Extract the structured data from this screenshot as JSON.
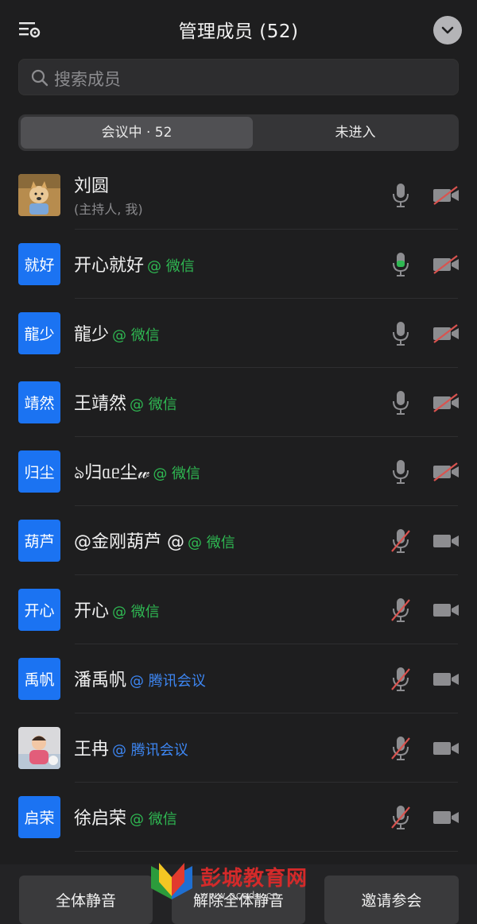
{
  "header": {
    "title": "管理成员 (52)",
    "settings_icon": "list-settings-icon",
    "collapse_icon": "chevron-down-icon"
  },
  "search": {
    "placeholder": "搜索成员"
  },
  "tabs": [
    {
      "label": "会议中 · 52",
      "active": true
    },
    {
      "label": "未进入",
      "active": false
    }
  ],
  "members": [
    {
      "avatar": "",
      "avatar_type": "photo-dog",
      "name": "刘圆",
      "sub": "(主持人, 我)",
      "source": "",
      "source_type": "",
      "mic": "on",
      "mic_active": false,
      "cam": "off"
    },
    {
      "avatar": "就好",
      "avatar_type": "text",
      "name": "开心就好",
      "sub": "",
      "source": "@ 微信",
      "source_type": "wx",
      "mic": "on",
      "mic_active": true,
      "cam": "off"
    },
    {
      "avatar": "龍少",
      "avatar_type": "text",
      "name": "龍少",
      "sub": "",
      "source": "@ 微信",
      "source_type": "wx",
      "mic": "on",
      "mic_active": false,
      "cam": "off"
    },
    {
      "avatar": "靖然",
      "avatar_type": "text",
      "name": "王靖然",
      "sub": "",
      "source": "@ 微信",
      "source_type": "wx",
      "mic": "on",
      "mic_active": false,
      "cam": "off"
    },
    {
      "avatar": "归尘",
      "avatar_type": "text",
      "name": "ঌ归ᥲᥱ尘𝓌",
      "sub": "",
      "source": "@ 微信",
      "source_type": "wx",
      "mic": "on",
      "mic_active": false,
      "cam": "off"
    },
    {
      "avatar": "葫芦",
      "avatar_type": "text",
      "name": "@金刚葫芦 @",
      "sub": "",
      "source": "@ 微信",
      "source_type": "wx",
      "mic": "off",
      "mic_active": false,
      "cam": "on"
    },
    {
      "avatar": "开心",
      "avatar_type": "text",
      "name": "开心",
      "sub": "",
      "source": "@ 微信",
      "source_type": "wx",
      "mic": "off",
      "mic_active": false,
      "cam": "on"
    },
    {
      "avatar": "禹帆",
      "avatar_type": "text",
      "name": "潘禹帆",
      "sub": "",
      "source": "@ 腾讯会议",
      "source_type": "tx",
      "mic": "off",
      "mic_active": false,
      "cam": "on"
    },
    {
      "avatar": "",
      "avatar_type": "photo-baby",
      "name": "王冉",
      "sub": "",
      "source": "@ 腾讯会议",
      "source_type": "tx",
      "mic": "off",
      "mic_active": false,
      "cam": "on"
    },
    {
      "avatar": "启荣",
      "avatar_type": "text",
      "name": "徐启荣",
      "sub": "",
      "source": "@ 微信",
      "source_type": "wx",
      "mic": "off",
      "mic_active": false,
      "cam": "on"
    }
  ],
  "bottom": {
    "mute_all": "全体静音",
    "unmute_all": "解除全体静音",
    "invite": "邀请参会"
  },
  "watermark": {
    "text": "彭城教育网",
    "url": "www.pcedu.cn"
  },
  "colors": {
    "accent_blue": "#1b73f2",
    "wechat_green": "#2fb852",
    "tencent_blue": "#3d86f2",
    "muted_red": "#d9534f"
  }
}
